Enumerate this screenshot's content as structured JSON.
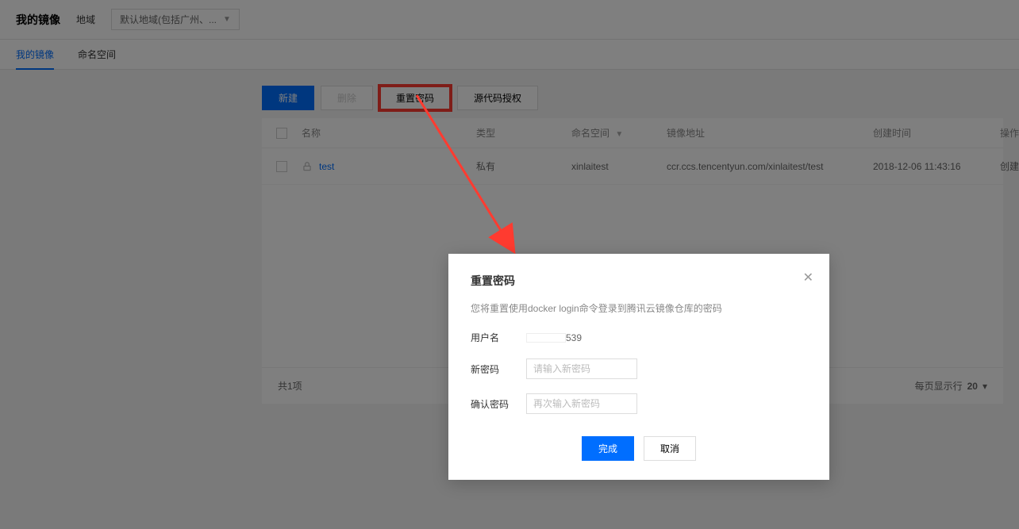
{
  "header": {
    "title": "我的镜像",
    "region_label": "地域",
    "region_value": "默认地域(包括广州、..."
  },
  "tabs": [
    {
      "label": "我的镜像",
      "active": true
    },
    {
      "label": "命名空间",
      "active": false
    }
  ],
  "toolbar": {
    "new_label": "新建",
    "delete_label": "删除",
    "reset_password_label": "重置密码",
    "source_auth_label": "源代码授权"
  },
  "table": {
    "headers": {
      "name": "名称",
      "type": "类型",
      "namespace": "命名空间",
      "address": "镜像地址",
      "created": "创建时间",
      "action": "操作"
    },
    "rows": [
      {
        "name": "test",
        "type": "私有",
        "namespace": "xinlaitest",
        "address": "ccr.ccs.tencentyun.com/xinlaitest/test",
        "created": "2018-12-06 11:43:16",
        "action": "创建"
      }
    ],
    "footer": {
      "total": "共1项",
      "per_page_label": "每页显示行",
      "per_page_value": "20"
    }
  },
  "modal": {
    "title": "重置密码",
    "desc": "您将重置使用docker login命令登录到腾讯云镜像仓库的密码",
    "username_label": "用户名",
    "username_suffix": "539",
    "password_label": "新密码",
    "password_placeholder": "请输入新密码",
    "confirm_label": "确认密码",
    "confirm_placeholder": "再次输入新密码",
    "ok_label": "完成",
    "cancel_label": "取消"
  }
}
